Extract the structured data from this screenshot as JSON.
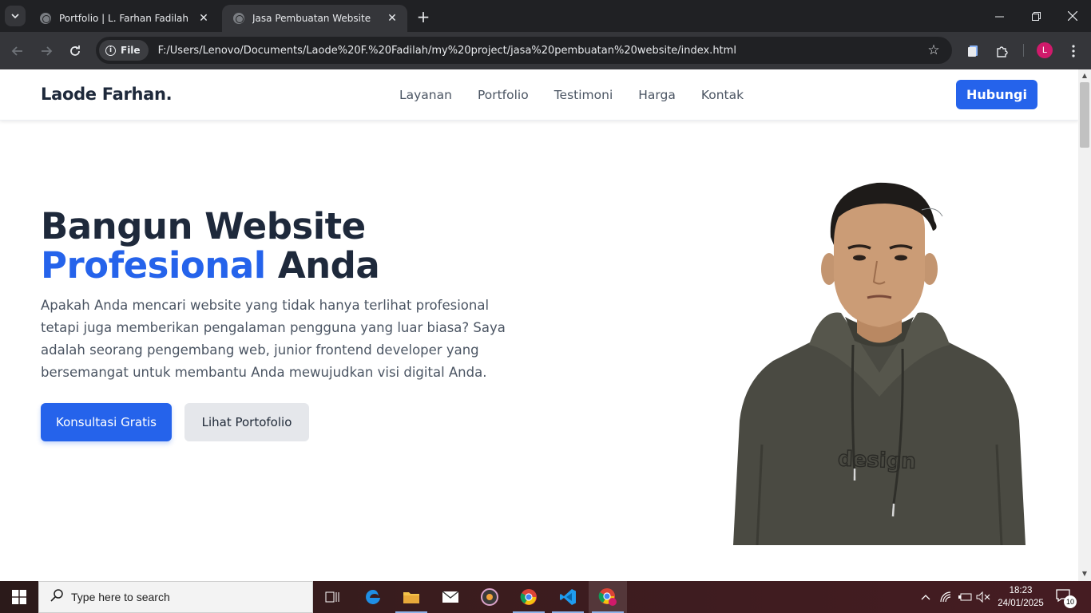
{
  "browser": {
    "tabs": [
      {
        "title": "Portfolio | L. Farhan Fadilah",
        "active": false
      },
      {
        "title": "Jasa Pembuatan Website",
        "active": true
      }
    ],
    "omnibox": {
      "scheme_chip": "File",
      "url": "F:/Users/Lenovo/Documents/Laode%20F.%20Fadilah/my%20project/jasa%20pembuatan%20website/index.html"
    },
    "profile_initial": "L",
    "icons": [
      "tab-search-icon",
      "close-icon",
      "new-tab-icon",
      "minimize-icon",
      "restore-icon",
      "window-close-icon",
      "back-icon",
      "forward-icon",
      "reload-icon",
      "info-icon",
      "bookmark-star-icon",
      "reading-list-icon",
      "extensions-icon",
      "menu-kebab-icon"
    ]
  },
  "site": {
    "brand": "Laode Farhan.",
    "nav": [
      {
        "label": "Layanan"
      },
      {
        "label": "Portfolio"
      },
      {
        "label": "Testimoni"
      },
      {
        "label": "Harga"
      },
      {
        "label": "Kontak"
      }
    ],
    "nav_cta": "Hubungi",
    "hero": {
      "title_line1": "Bangun Website",
      "title_accent": "Profesional",
      "title_rest": "Anda",
      "description": "Apakah Anda mencari website yang tidak hanya terlihat profesional tetapi juga memberikan pengalaman pengguna yang luar biasa? Saya adalah seorang pengembang web, junior frontend developer yang bersemangat untuk membantu Anda mewujudkan visi digital Anda.",
      "primary_button": "Konsultasi Gratis",
      "secondary_button": "Lihat Portofolio",
      "hoodie_text": "design"
    },
    "colors": {
      "accent": "#2563eb",
      "heading": "#1e293b",
      "body_text": "#4b5563",
      "secondary_button_bg": "#e5e7eb"
    }
  },
  "taskbar": {
    "search_placeholder": "Type here to search",
    "apps": [
      "task-view-icon",
      "edge-icon",
      "file-explorer-icon",
      "mail-icon",
      "media-app-icon",
      "chrome-icon",
      "vscode-icon",
      "chrome-profile-icon"
    ],
    "time": "18:23",
    "date": "24/01/2025",
    "notification_count": "10"
  }
}
